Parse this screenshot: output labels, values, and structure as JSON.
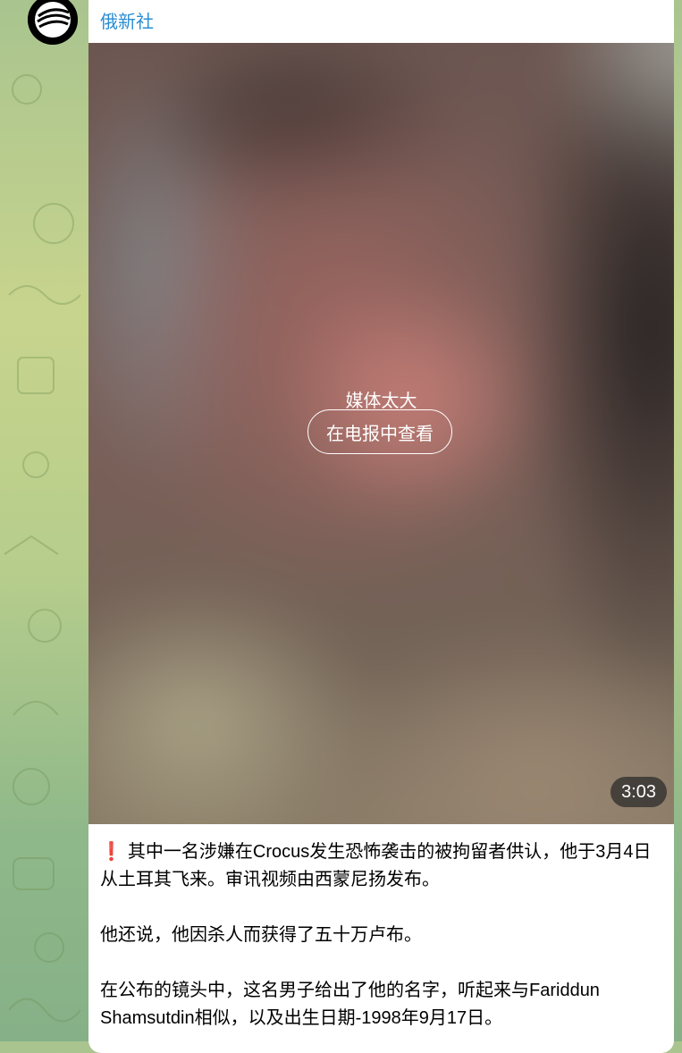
{
  "channel": {
    "name": "俄新社",
    "avatar_icon": "ria-logo-icon"
  },
  "media": {
    "overlay_title": "媒体太大",
    "view_button_label": "在电报中查看",
    "duration": "3:03"
  },
  "message": {
    "emoji": "❗",
    "paragraphs": [
      "其中一名涉嫌在Crocus发生恐怖袭击的被拘留者供认，他于3月4日从土耳其飞来。审讯视频由西蒙尼扬发布。",
      "他还说，他因杀人而获得了五十万卢布。",
      "在公布的镜头中，这名男子给出了他的名字，听起来与Fariddun Shamsutdin相似，以及出生日期-1998年9月17日。"
    ]
  },
  "colors": {
    "channel_name": "#2a8dd4",
    "emoji_red": "#e0252b"
  }
}
